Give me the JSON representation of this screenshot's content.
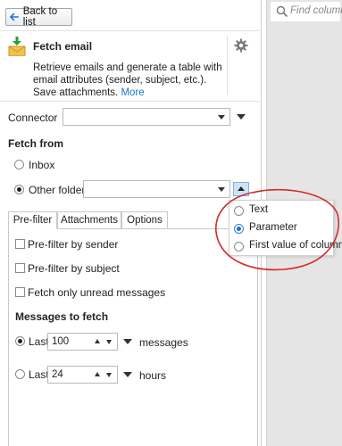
{
  "search": {
    "placeholder": "Find column"
  },
  "header": {
    "back_label": "Back to list",
    "title": "Fetch email",
    "description": "Retrieve emails and generate a table with email attributes (sender, subject, etc.). Save attachments.",
    "more_link": "More"
  },
  "form": {
    "connector_label": "Connector",
    "connector_value": "",
    "fetch_from_label": "Fetch from",
    "inbox_label": "Inbox",
    "other_folder_label": "Other folder",
    "other_folder_value": "",
    "fetch_from_selected": "Other folder"
  },
  "popup": {
    "options": [
      "Text",
      "Parameter",
      "First value of column"
    ],
    "selected": "Parameter"
  },
  "tabs": [
    "Pre-filter",
    "Attachments",
    "Options"
  ],
  "active_tab": "Pre-filter",
  "prefilter": {
    "by_sender": "Pre-filter by sender",
    "by_subject": "Pre-filter by subject",
    "unread_only": "Fetch only unread messages",
    "messages_to_fetch": "Messages to fetch",
    "last_label": "Last",
    "messages_value": "100",
    "messages_unit": "messages",
    "last_label_2": "Last",
    "hours_value": "24",
    "hours_unit": "hours",
    "selected_mode": "messages"
  },
  "colors": {
    "accent": "#1e6fd9",
    "link": "#1a73c8",
    "annotation": "#d42a2a",
    "right_panel": "#e5e5e5"
  }
}
